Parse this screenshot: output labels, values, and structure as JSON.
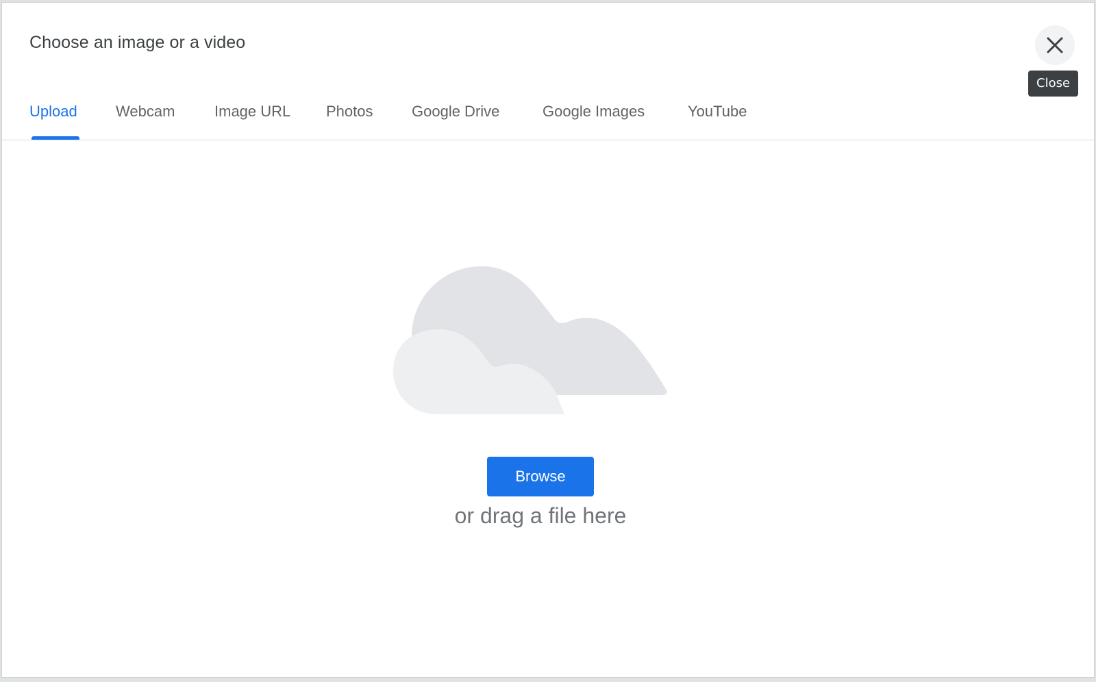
{
  "dialog": {
    "title": "Choose an image or a video",
    "close_tooltip": "Close"
  },
  "tabs": [
    {
      "label": "Upload",
      "active": true
    },
    {
      "label": "Webcam",
      "active": false
    },
    {
      "label": "Image URL",
      "active": false
    },
    {
      "label": "Photos",
      "active": false
    },
    {
      "label": "Google Drive",
      "active": false
    },
    {
      "label": "Google Images",
      "active": false
    },
    {
      "label": "YouTube",
      "active": false
    }
  ],
  "upload": {
    "browse_label": "Browse",
    "drag_text": "or drag a file here"
  },
  "icons": {
    "close": "close-icon",
    "illustration": "cloud-upload-illustration"
  },
  "colors": {
    "accent": "#1a73e8",
    "text": "#3c4043",
    "muted": "#5f6368"
  }
}
